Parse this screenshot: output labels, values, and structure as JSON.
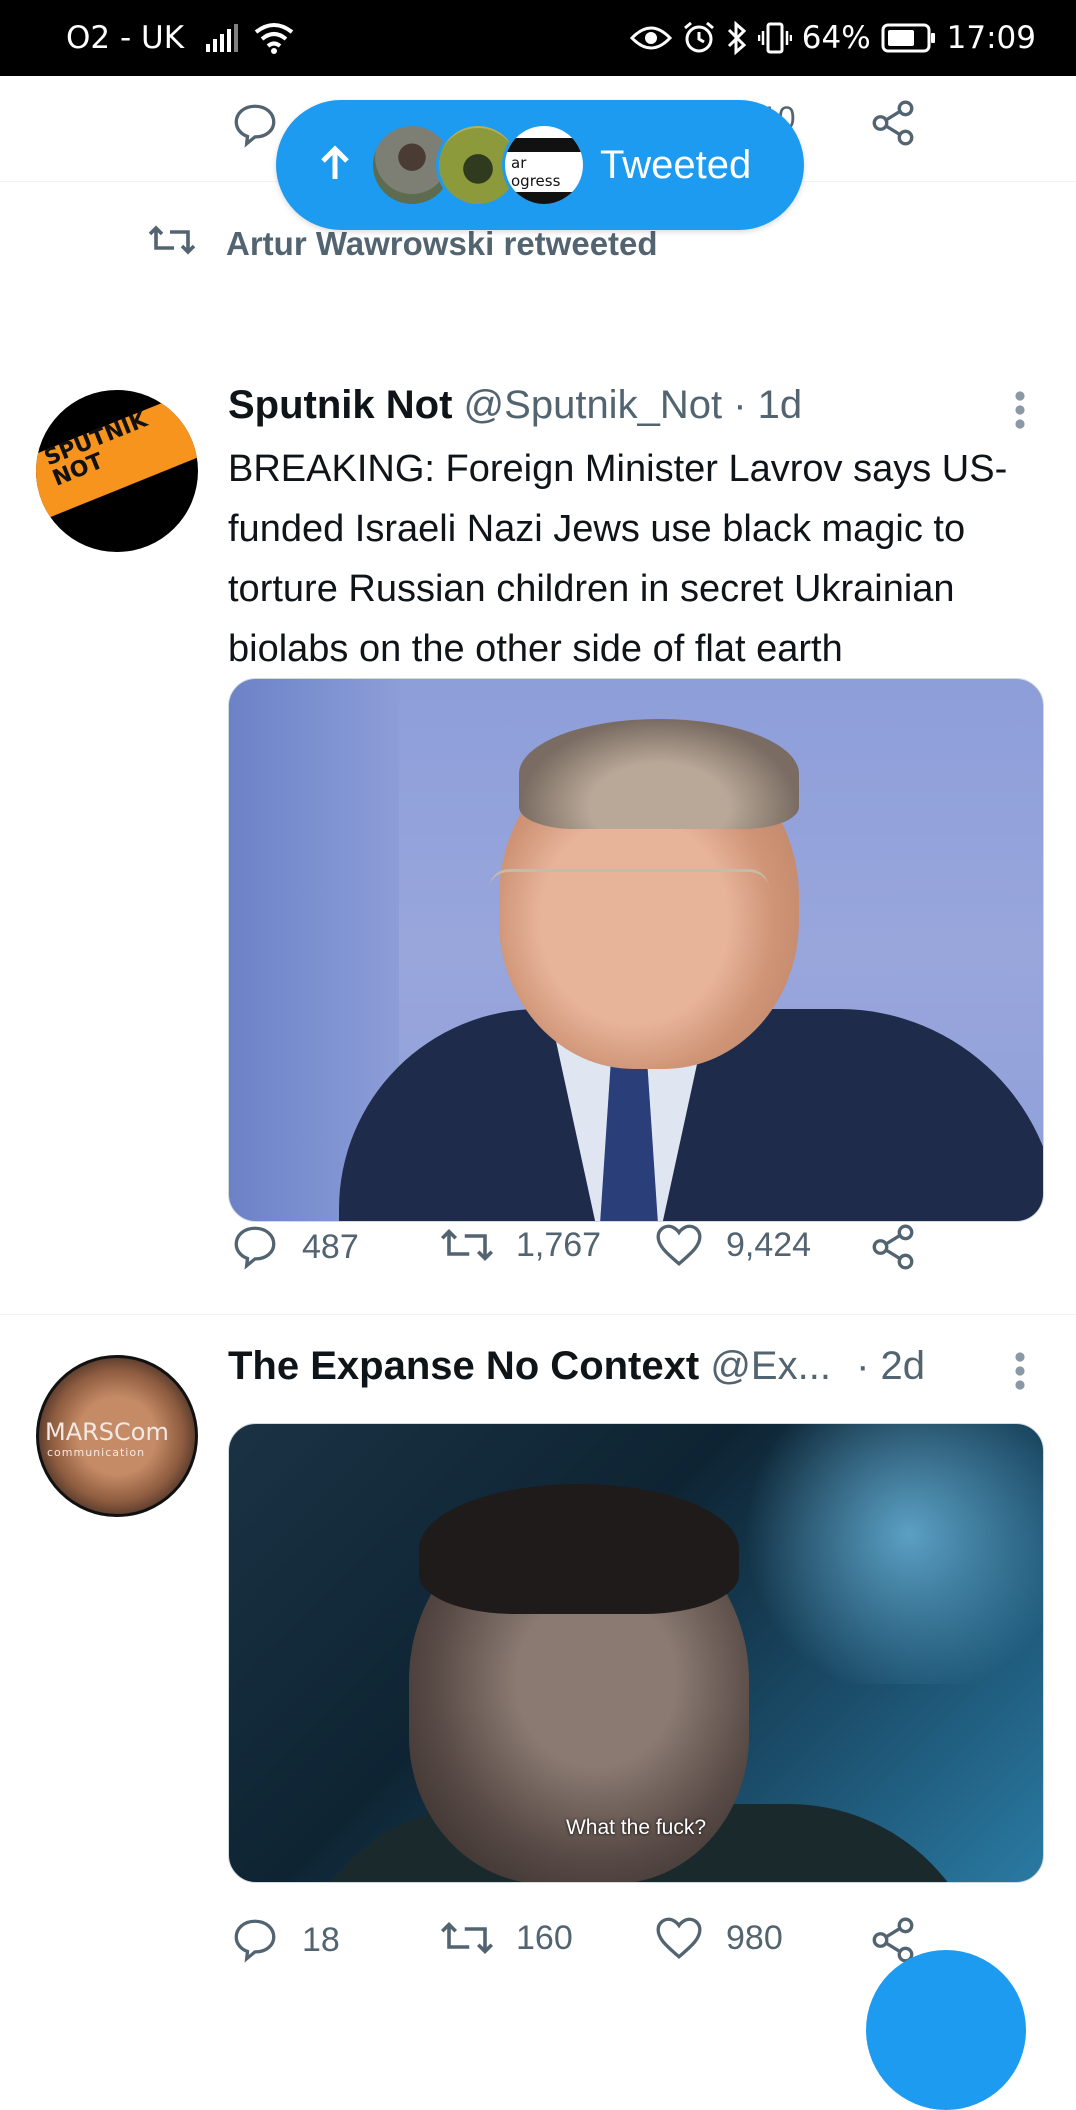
{
  "status_bar": {
    "carrier": "O2 - UK",
    "battery": "64%",
    "time": "17:09",
    "icons": [
      "signal-icon",
      "wifi-icon",
      "eye-icon",
      "alarm-icon",
      "bluetooth-icon",
      "vibrate-icon",
      "battery-icon"
    ]
  },
  "previous_tweet": {
    "visible_count_fragment": "10"
  },
  "new_tweets_pill": {
    "label": "Tweeted",
    "avatar3_text": [
      "ar",
      "ogress"
    ]
  },
  "tweets": [
    {
      "retweeted_by": "Artur Wawrowski retweeted",
      "name": "Sputnik Not",
      "handle": "@Sputnik_Not",
      "separator": "·",
      "time": "1d",
      "avatar_text": [
        "SPUTNIK",
        "NOT"
      ],
      "text": "BREAKING: Foreign Minister Lavrov says US-funded Israeli Nazi Jews use black magic to torture Russian children in secret Ukrainian biolabs on the other side of flat earth",
      "replies": "487",
      "retweets": "1,767",
      "likes": "9,424"
    },
    {
      "name": "The Expanse No Context",
      "handle": "@Ex...",
      "separator": "·",
      "time": "2d",
      "avatar_text": [
        "MARSCom",
        "communication"
      ],
      "media_subtitle": "What the fuck?",
      "replies": "18",
      "retweets": "160",
      "likes": "980"
    }
  ],
  "colors": {
    "accent": "#1d9bf0",
    "secondary_text": "#536471",
    "primary_text": "#0f1419"
  }
}
